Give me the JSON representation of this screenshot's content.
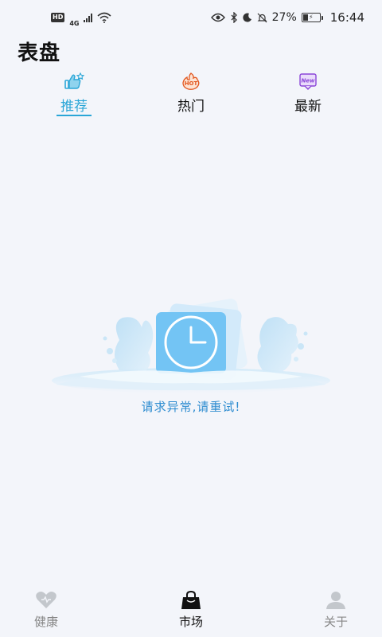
{
  "status_bar": {
    "network_badge": "HD",
    "network_type": "4G",
    "battery": "27%",
    "time": "16:44",
    "icons": [
      "eye-icon",
      "bluetooth-icon",
      "moon-icon",
      "bell-off-icon",
      "battery-icon"
    ]
  },
  "header": {
    "title": "表盘"
  },
  "tabs": [
    {
      "label": "推荐",
      "icon": "thumbs-up-star-icon",
      "active": true
    },
    {
      "label": "热门",
      "icon": "hot-badge-icon",
      "active": false
    },
    {
      "label": "最新",
      "icon": "new-badge-icon",
      "active": false
    }
  ],
  "empty_state": {
    "illustration": "clock-splash-illustration",
    "message": "请求异常,请重试!"
  },
  "bottom_nav": [
    {
      "label": "健康",
      "icon": "heart-icon",
      "active": false
    },
    {
      "label": "市场",
      "icon": "shopping-bag-icon",
      "active": true
    },
    {
      "label": "关于",
      "icon": "user-icon",
      "active": false
    }
  ],
  "colors": {
    "accent": "#2aa6d7",
    "background": "#f3f5fa",
    "error_text": "#2d8cd0",
    "inactive_nav": "#888888"
  }
}
